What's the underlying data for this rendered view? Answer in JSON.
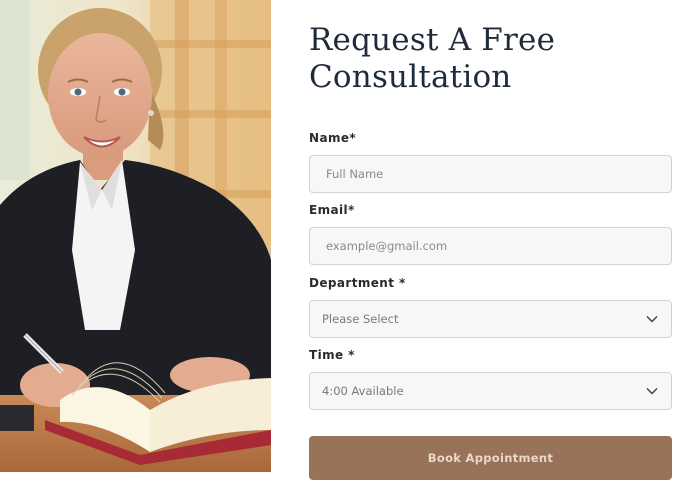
{
  "form": {
    "title_line1": "Request A Free",
    "title_line2": "Consultation",
    "name_label": "Name*",
    "name_placeholder": "Full Name",
    "email_label": "Email*",
    "email_placeholder": "example@gmail.com",
    "department_label": "Department *",
    "department_value": "Please Select",
    "time_label": "Time *",
    "time_value": "4:00 Available",
    "submit_label": "Book Appointment"
  },
  "icons": {
    "dropdown": "chevron-down-icon"
  },
  "colors": {
    "title": "#1f2b3c",
    "button_bg": "#98735a",
    "button_text": "#ead8c9",
    "field_bg": "#f7f7f7",
    "field_border": "#d3d3d3"
  }
}
